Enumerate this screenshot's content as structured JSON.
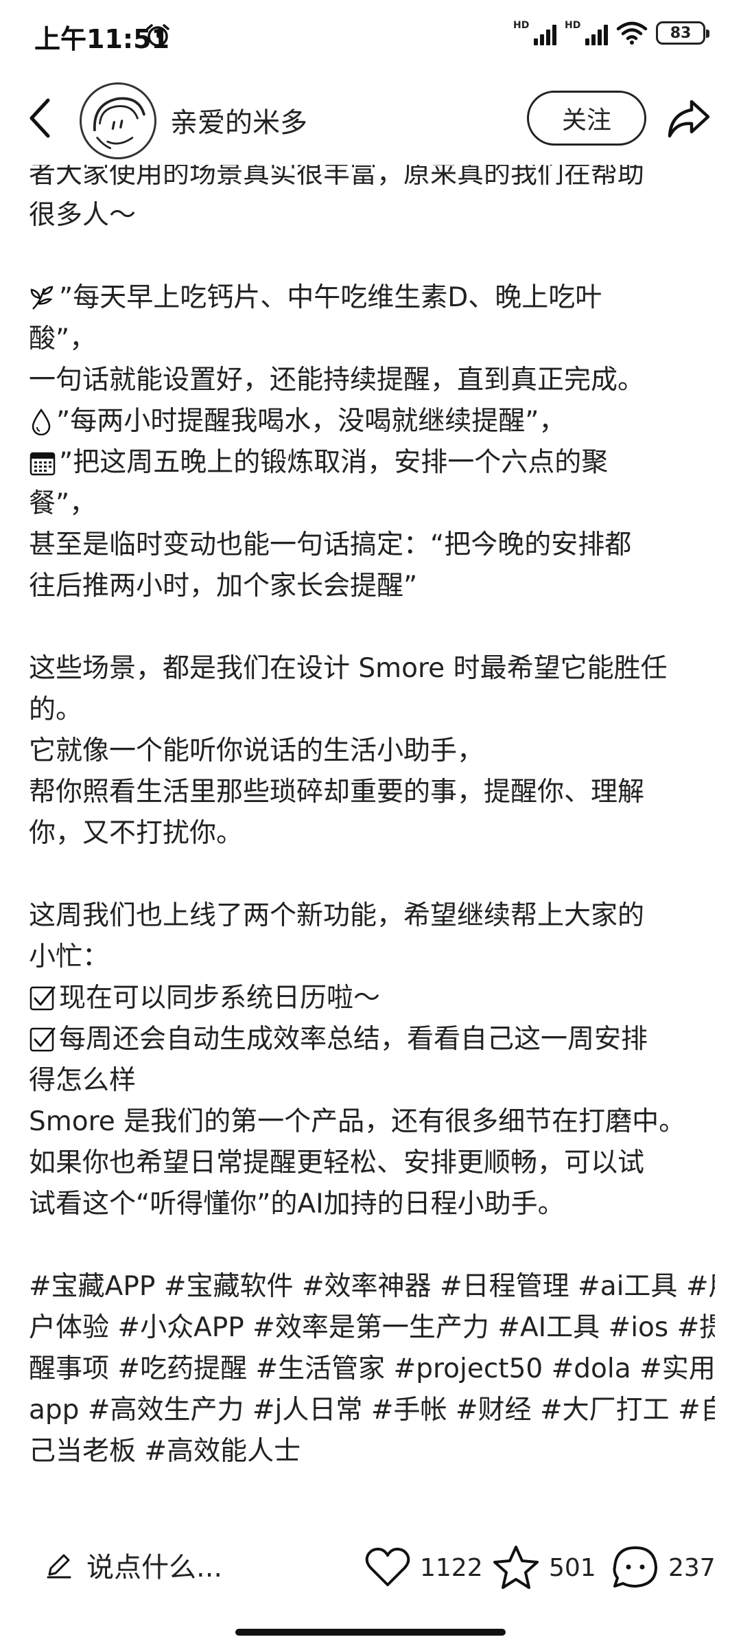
{
  "status_bar": {
    "time": "上午11:51",
    "battery": "83",
    "icons": [
      "alarm-icon",
      "signal-hd-icon",
      "signal-hd-icon",
      "wifi-icon",
      "battery-icon"
    ]
  },
  "header": {
    "author_name": "亲爱的米多",
    "follow_label": "关注",
    "icons": [
      "back-icon",
      "avatar",
      "share-icon"
    ]
  },
  "content": {
    "line_01": "者大家使用的场景真实很丰富，原来真的我们在帮助",
    "line_02": "很多人～",
    "line_03": "”每天早上吃钙片、中午吃维生素D、晚上吃叶",
    "line_04": "酸”，",
    "line_05": "一句话就能设置好，还能持续提醒，直到真正完成。",
    "line_06": "”每两小时提醒我喝水，没喝就继续提醒”，",
    "line_07": "”把这周五晚上的锻炼取消，安排一个六点的聚",
    "line_08": "餐”，",
    "line_09": "甚至是临时变动也能一句话搞定：“把今晚的安排都",
    "line_10": "往后推两小时，加个家长会提醒”",
    "line_11": "这些场景，都是我们在设计 Smore 时最希望它能胜任",
    "line_12": "的。",
    "line_13": "它就像一个能听你说话的生活小助手，",
    "line_14": "帮你照看生活里那些琐碎却重要的事，提醒你、理解",
    "line_15": "你，又不打扰你。",
    "line_16": "这周我们也上线了两个新功能，希望继续帮上大家的",
    "line_17": "小忙：",
    "line_18": "现在可以同步系统日历啦～",
    "line_19": "每周还会自动生成效率总结，看看自己这一周安排",
    "line_20": "得怎么样",
    "line_21": "Smore 是我们的第一个产品，还有很多细节在打磨中。",
    "line_22": "如果你也希望日常提醒更轻松、安排更顺畅，可以试",
    "line_23": "试看这个“听得懂你”的AI加持的日程小助手。",
    "line_24": "#宝藏APP #宝藏软件 #效率神器 #日程管理 #ai工具 #用",
    "line_25": "户体验 #小众APP #效率是第一生产力 #AI工具 #ios #提",
    "line_26": "醒事项 #吃药提醒 #生活管家 #project50 #dola #实用",
    "line_27": "app #高效生产力 #j人日常 #手帐 #财经 #大厂打工 #自",
    "line_28": "己当老板 #高效能人士",
    "emojis": [
      "herb-icon",
      "droplet-icon",
      "calendar-icon",
      "check-box-icon",
      "check-box-icon"
    ]
  },
  "bottom_bar": {
    "comment_placeholder": "说点什么...",
    "likes": "1122",
    "stars": "501",
    "comments": "237",
    "icons": [
      "pencil-icon",
      "heart-icon",
      "star-icon",
      "comment-bubble-icon"
    ]
  }
}
